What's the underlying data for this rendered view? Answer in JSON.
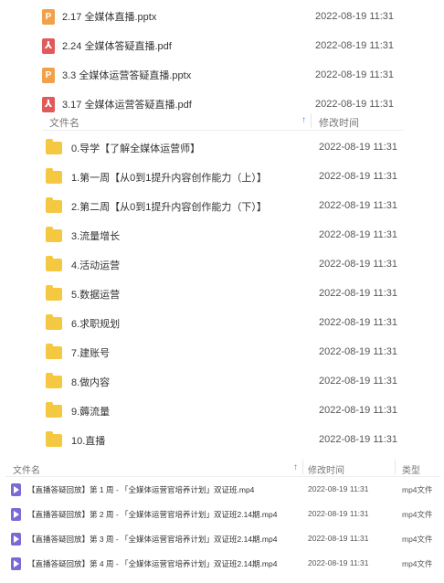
{
  "top_files": [
    {
      "icon": "ppt",
      "name": "2.17 全媒体直播.pptx",
      "date": "2022-08-19 11:31"
    },
    {
      "icon": "pdf",
      "name": "2.24 全媒体答疑直播.pdf",
      "date": "2022-08-19 11:31"
    },
    {
      "icon": "ppt",
      "name": "3.3 全媒体运营答疑直播.pptx",
      "date": "2022-08-19 11:31"
    },
    {
      "icon": "pdf",
      "name": "3.17 全媒体运营答疑直播.pdf",
      "date": "2022-08-19 11:31"
    }
  ],
  "folder_header": {
    "name": "文件名",
    "date": "修改时间"
  },
  "folders": [
    {
      "name": "0.导学【了解全媒体运营师】",
      "date": "2022-08-19 11:31"
    },
    {
      "name": "1.第一周【从0到1提升内容创作能力（上）】",
      "date": "2022-08-19 11:31"
    },
    {
      "name": "2.第二周【从0到1提升内容创作能力（下）】",
      "date": "2022-08-19 11:31"
    },
    {
      "name": "3.流量增长",
      "date": "2022-08-19 11:31"
    },
    {
      "name": "4.活动运营",
      "date": "2022-08-19 11:31"
    },
    {
      "name": "5.数据运营",
      "date": "2022-08-19 11:31"
    },
    {
      "name": "6.求职规划",
      "date": "2022-08-19 11:31"
    },
    {
      "name": "7.建账号",
      "date": "2022-08-19 11:31"
    },
    {
      "name": "8.做内容",
      "date": "2022-08-19 11:31"
    },
    {
      "name": "9.薅流量",
      "date": "2022-08-19 11:31"
    },
    {
      "name": "10.直播",
      "date": "2022-08-19 11:31"
    }
  ],
  "video_header": {
    "name": "文件名",
    "date": "修改时间",
    "type": "类型"
  },
  "videos": [
    {
      "name": "【直播答疑回放】第 1 周 - 「全媒体运营官培养计划」双证班.mp4",
      "date": "2022-08-19 11:31",
      "type": "mp4文件"
    },
    {
      "name": "【直播答疑回放】第 2 周 - 「全媒体运营官培养计划」双证班2.14期.mp4",
      "date": "2022-08-19 11:31",
      "type": "mp4文件"
    },
    {
      "name": "【直播答疑回放】第 3 周 - 「全媒体运营官培养计划」双证班2.14期.mp4",
      "date": "2022-08-19 11:31",
      "type": "mp4文件"
    },
    {
      "name": "【直播答疑回放】第 4 周 - 「全媒体运营官培养计划」双证班2.14期.mp4",
      "date": "2022-08-19 11:31",
      "type": "mp4文件"
    }
  ],
  "sort_arrow": "↑"
}
